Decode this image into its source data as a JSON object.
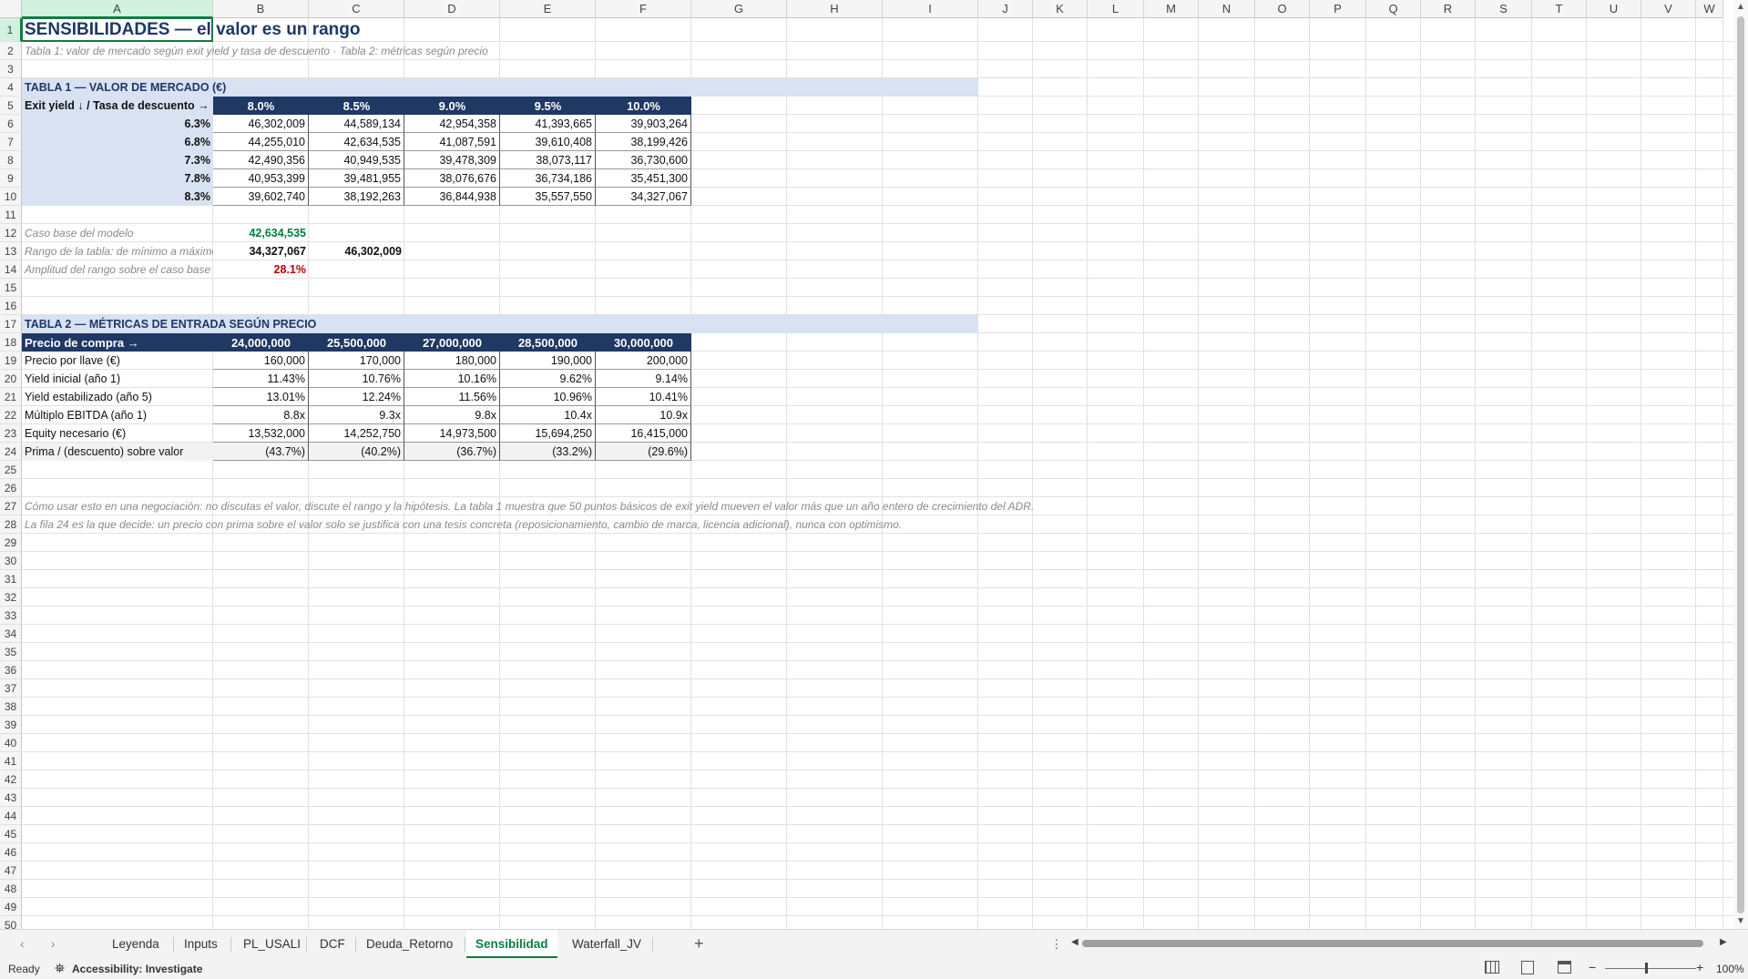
{
  "columns": [
    "A",
    "B",
    "C",
    "D",
    "E",
    "F",
    "G",
    "H",
    "I",
    "J",
    "K",
    "L",
    "M",
    "N",
    "O",
    "P",
    "Q",
    "R",
    "S",
    "T",
    "U",
    "V",
    "W"
  ],
  "rows": [
    "1",
    "2",
    "3",
    "4",
    "5",
    "6",
    "7",
    "8",
    "9",
    "10",
    "11",
    "12",
    "13",
    "14",
    "15",
    "16",
    "17",
    "18",
    "19",
    "20",
    "21",
    "22",
    "23",
    "24",
    "25",
    "26",
    "27",
    "28",
    "29",
    "30",
    "31",
    "32",
    "33",
    "34",
    "35",
    "36",
    "37",
    "38",
    "39",
    "40",
    "41",
    "42",
    "43",
    "44",
    "45",
    "46",
    "47",
    "48",
    "49",
    "50"
  ],
  "sheet": {
    "title": "SENSIBILIDADES — el valor es un rango",
    "subtitle": "Tabla 1: valor de mercado según exit yield y tasa de descuento · Tabla 2: métricas según precio",
    "table1": {
      "section": "TABLA 1 — VALOR DE MERCADO (€)",
      "corner_label": "Exit yield ↓ / Tasa de descuento →",
      "discount_rates": [
        "8.0%",
        "8.5%",
        "9.0%",
        "9.5%",
        "10.0%"
      ],
      "rows": [
        {
          "yield": "6.3%",
          "values": [
            "46,302,009",
            "44,589,134",
            "42,954,358",
            "41,393,665",
            "39,903,264"
          ]
        },
        {
          "yield": "6.8%",
          "values": [
            "44,255,010",
            "42,634,535",
            "41,087,591",
            "39,610,408",
            "38,199,426"
          ]
        },
        {
          "yield": "7.3%",
          "values": [
            "42,490,356",
            "40,949,535",
            "39,478,309",
            "38,073,117",
            "36,730,600"
          ]
        },
        {
          "yield": "7.8%",
          "values": [
            "40,953,399",
            "39,481,955",
            "38,076,676",
            "36,734,186",
            "35,451,300"
          ]
        },
        {
          "yield": "8.3%",
          "values": [
            "39,602,740",
            "38,192,263",
            "36,844,938",
            "35,557,550",
            "34,327,067"
          ]
        }
      ]
    },
    "summary": {
      "base_label": "Caso base del modelo",
      "base_value": "42,634,535",
      "range_label": "Rango de la tabla: de mínimo a máximo",
      "range_min": "34,327,067",
      "range_max": "46,302,009",
      "amp_label": "Amplitud del rango sobre el caso base",
      "amp_value": "28.1%"
    },
    "table2": {
      "section": "TABLA 2 — MÉTRICAS DE ENTRADA SEGÚN PRECIO",
      "header_label": "Precio de compra →",
      "prices": [
        "24,000,000",
        "25,500,000",
        "27,000,000",
        "28,500,000",
        "30,000,000"
      ],
      "rows": [
        {
          "label": "Precio por llave (€)",
          "values": [
            "160,000",
            "170,000",
            "180,000",
            "190,000",
            "200,000"
          ]
        },
        {
          "label": "Yield inicial (año 1)",
          "values": [
            "11.43%",
            "10.76%",
            "10.16%",
            "9.62%",
            "9.14%"
          ]
        },
        {
          "label": "Yield estabilizado (año 5)",
          "values": [
            "13.01%",
            "12.24%",
            "11.56%",
            "10.96%",
            "10.41%"
          ]
        },
        {
          "label": "Múltiplo EBITDA (año 1)",
          "values": [
            "8.8x",
            "9.3x",
            "9.8x",
            "10.4x",
            "10.9x"
          ]
        },
        {
          "label": "Equity necesario (€)",
          "values": [
            "13,532,000",
            "14,252,750",
            "14,973,500",
            "15,694,250",
            "16,415,000"
          ]
        },
        {
          "label": "Prima / (descuento) sobre valor",
          "values": [
            "(43.7%)",
            "(40.2%)",
            "(36.7%)",
            "(33.2%)",
            "(29.6%)"
          ]
        }
      ]
    },
    "note1": "Cómo usar esto en una negociación: no discutas el valor, discute el rango y la hipótesis. La tabla 1 muestra que 50 puntos básicos de exit yield mueven el valor más que un año entero de crecimiento del ADR.",
    "note2": "La fila 24 es la que decide: un precio con prima sobre el valor solo se justifica con una tesis concreta (reposicionamiento, cambio de marca, licencia adicional), nunca con optimismo."
  },
  "tabs": [
    "Leyenda",
    "Inputs",
    "PL_USALI",
    "DCF",
    "Deuda_Retorno",
    "Sensibilidad",
    "Waterfall_JV"
  ],
  "active_tab": "Sensibilidad",
  "status": {
    "ready": "Ready",
    "accessibility": "Accessibility: Investigate",
    "zoom": "100%"
  },
  "colors": {
    "accent": "#107c41",
    "navy": "#1f3864",
    "section_bg": "#d9e2f3",
    "green": "#00803c",
    "red": "#c00000"
  }
}
